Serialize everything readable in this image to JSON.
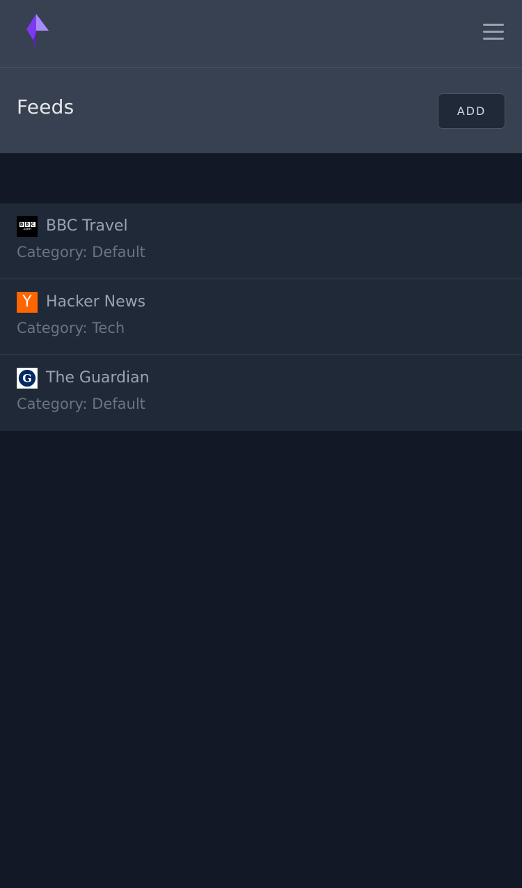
{
  "header": {
    "logo": "app-logo",
    "menu_icon": "hamburger-menu-icon"
  },
  "page": {
    "title": "Feeds",
    "add_button_label": "ADD"
  },
  "feeds": [
    {
      "name": "BBC Travel",
      "category_label": "Category:",
      "category": "Default",
      "icon": "bbc-favicon",
      "icon_text": [
        "B",
        "B",
        "C"
      ],
      "icon_subtext": ".com"
    },
    {
      "name": "Hacker News",
      "category_label": "Category:",
      "category": "Tech",
      "icon": "hacker-news-favicon",
      "icon_text": "Y"
    },
    {
      "name": "The Guardian",
      "category_label": "Category:",
      "category": "Default",
      "icon": "guardian-favicon",
      "icon_text": "G"
    }
  ],
  "colors": {
    "background": "#121826",
    "header_background": "#374151",
    "list_background": "#1f2937",
    "accent_purple": "#7c3aed",
    "hn_orange": "#ff6600",
    "guardian_blue": "#052962"
  }
}
